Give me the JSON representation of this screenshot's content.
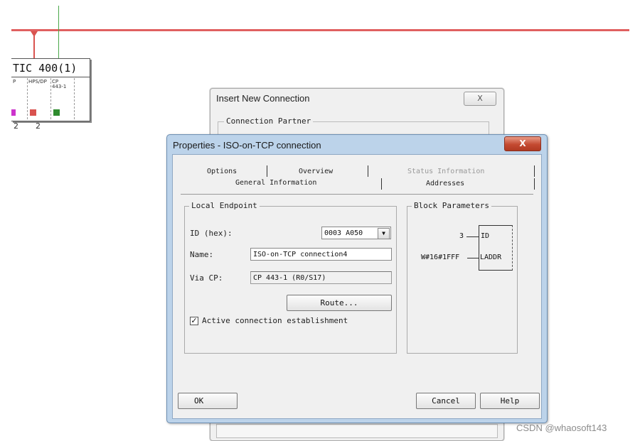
{
  "network": {
    "station_title": "TIC 400(1)",
    "slots": [
      {
        "label": "P",
        "color": ""
      },
      {
        "label": "HPS/DP",
        "color": "#d9534f"
      },
      {
        "label": "CP 443-1",
        "color": "#2e8b2e"
      }
    ],
    "first_slot_module_color": "#cc33cc",
    "slot_numbers": [
      "2",
      "2"
    ]
  },
  "insert_dialog": {
    "title": "Insert New Connection",
    "close_label": "X",
    "group_label": "Connection Partner"
  },
  "properties_dialog": {
    "title": "Properties - ISO-on-TCP connection",
    "close_label": "X",
    "tabs_row1": [
      "Options",
      "Overview",
      "Status Information"
    ],
    "tabs_row2": [
      "General Information",
      "Addresses"
    ],
    "local_endpoint": {
      "group_label": "Local Endpoint",
      "id_label": "ID (hex):",
      "id_value": "0003 A050",
      "name_label": "Name:",
      "name_value": "ISO-on-TCP connection4",
      "via_cp_label": "Via CP:",
      "via_cp_value": "CP 443-1 (R0/S17)",
      "route_button": "Route...",
      "active_checkbox_label": "Active connection establishment",
      "active_checked": true,
      "check_mark": "✓"
    },
    "block_parameters": {
      "group_label": "Block Parameters",
      "id_in_value": "3",
      "id_pin": "ID",
      "laddr_in_value": "W#16#1FFF",
      "laddr_pin": "LADDR"
    },
    "buttons": {
      "ok": "OK",
      "cancel": "Cancel",
      "help": "Help"
    }
  },
  "watermark": "CSDN @whaosoft143"
}
